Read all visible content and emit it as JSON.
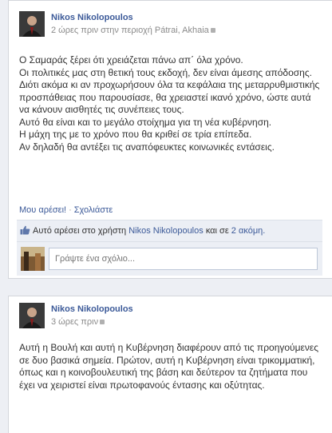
{
  "posts": [
    {
      "author": "Nikos Nikolopoulos",
      "meta": "2 ώρες πριν στην περιοχή Pátrai, Akhaia",
      "text": "Ο Σαμαράς ξέρει ότι χρειάζεται πάνω απ΄ όλα χρόνο.\nΟι πολιτικές μας στη θετική τους εκδοχή, δεν είναι άμεσης απόδοσης.\nΔιότι ακόμα κι αν προχωρήσουν όλα τα κεφάλαια της μεταρρυθμιστικής προσπάθειας που παρουσίασε, θα χρειαστεί ικανό χρόνο, ώστε αυτά να κάνουν αισθητές τις συνέπειες τους.\nΑυτό θα είναι και το μεγάλο στοίχημα για τη νέα κυβέρνηση.\nΗ μάχη της με το χρόνο που θα κριθεί σε τρία επίπεδα.\nΑν δηλαδή θα αντέξει τις αναπόφευκτες κοινωνικές εντάσεις.",
      "like_label": "Μου αρέσει!",
      "comment_label": "Σχολιάστε",
      "likes_prefix": "Αυτό αρέσει στο χρήστη",
      "likes_user": "Nikos Nikolopoulos",
      "likes_mid": "και σε",
      "likes_more": "2 ακόμη.",
      "comment_placeholder": "Γράψτε ένα σχόλιο..."
    },
    {
      "author": "Nikos Nikolopoulos",
      "meta": "3 ώρες πριν",
      "text": "Αυτή η Βουλή και αυτή η Κυβέρνηση διαφέρουν από τις προηγούμενες σε δυο βασικά σημεία. Πρώτον, αυτή η Κυβέρνηση είναι τρικομματική, όπως και η κοινοβουλευτική της βάση και δεύτερον τα ζητήματα που έχει να χειριστεί είναι πρωτοφανούς έντασης και οξύτητας."
    }
  ],
  "colors": {
    "link": "#3b5998",
    "background": "#edeff4",
    "feedback": "#eceff5"
  },
  "icons": {
    "privacy": "globe-icon",
    "like": "thumbs-up-icon"
  }
}
